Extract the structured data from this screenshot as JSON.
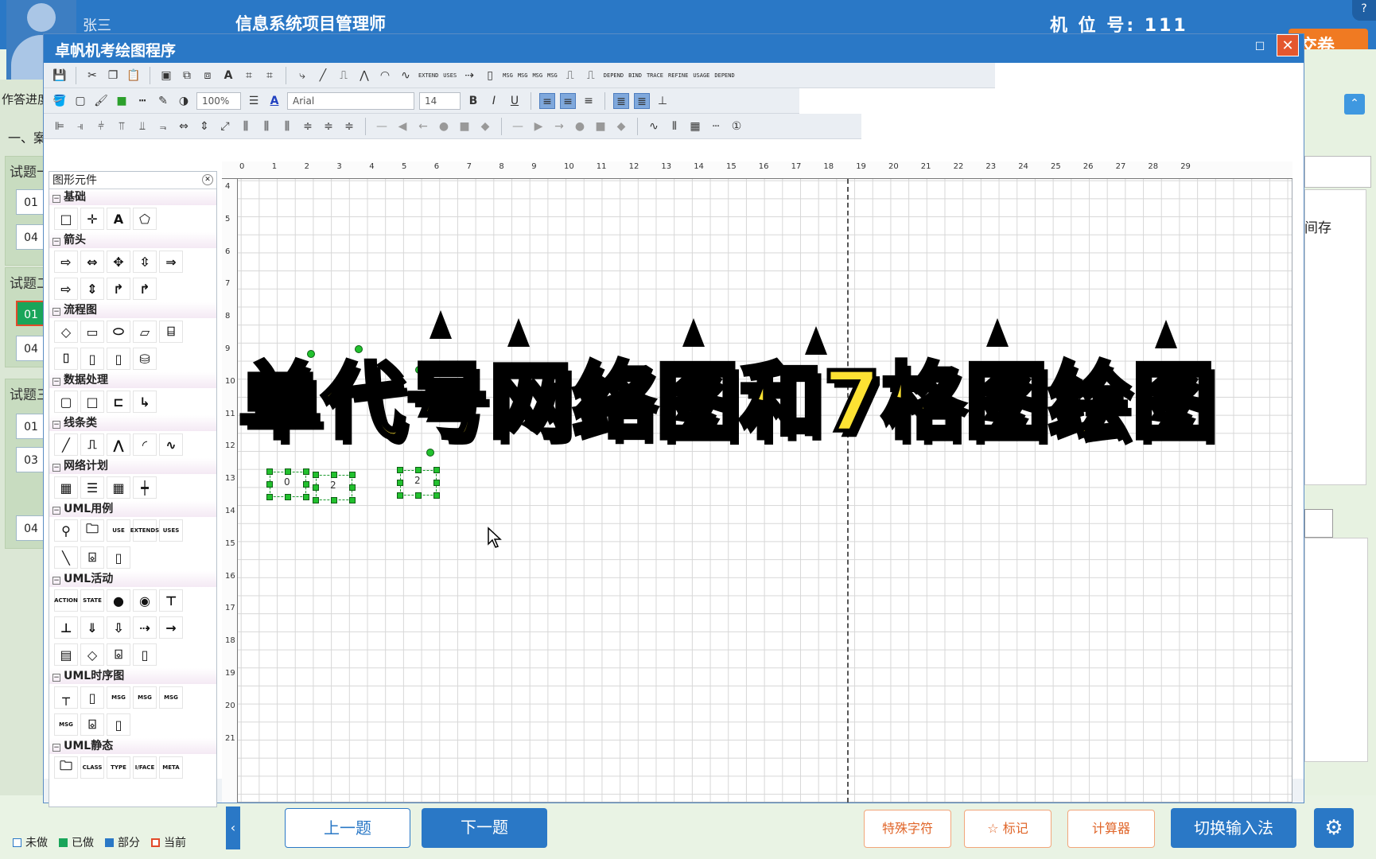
{
  "app": {
    "user_name": "张三",
    "exam_title": "信息系统项目管理师",
    "seat_label": "机 位 号: 111",
    "submit_label": "交卷",
    "help_label": "?",
    "progress_label": "作答进度",
    "section_label": "一、案"
  },
  "questions": [
    {
      "title": "试题一",
      "nums": [
        "01",
        "04"
      ],
      "current": null
    },
    {
      "title": "试题二",
      "nums": [
        "01",
        "04"
      ],
      "current": "01"
    },
    {
      "title": "试题三",
      "nums": [
        "01",
        "03",
        "04"
      ],
      "current": null
    }
  ],
  "right_panel": {
    "text": "间存"
  },
  "bottom": {
    "legend": [
      {
        "label": "未做",
        "color": "#ffffff"
      },
      {
        "label": "已做",
        "color": "#19a55a"
      },
      {
        "label": "部分",
        "color": "#2a78c6"
      },
      {
        "label": "当前",
        "color": "#e24a2a"
      }
    ],
    "prev_label": "上一题",
    "next_label": "下一题",
    "special_char_label": "特殊字符",
    "mark_label": "标记",
    "calculator_label": "计算器",
    "ime_label": "切换输入法"
  },
  "draw_window": {
    "title": "卓帆机考绘图程序",
    "zoom": "100%",
    "font_name": "Arial",
    "font_size": "14",
    "palette_title": "图形元件",
    "categories": [
      {
        "name": "基础",
        "rows": [
          [
            "rect-icon",
            "cross-icon",
            "text-icon",
            "polygon-icon"
          ]
        ]
      },
      {
        "name": "箭头",
        "rows": [
          [
            "arrow-right-icon",
            "arrow-lr-icon",
            "arrow-4way-icon",
            "arrow-3way-icon",
            "chevron-icon"
          ],
          [
            "arrow-tab-icon",
            "arrow-ud-icon",
            "bent-arrow-icon",
            "bent-arrow2-icon"
          ]
        ]
      },
      {
        "name": "流程图",
        "rows": [
          [
            "diamond-icon",
            "process-icon",
            "terminator-icon",
            "data-icon",
            "document-icon"
          ],
          [
            "card-icon",
            "page-icon",
            "drum-icon",
            "cylinder-icon"
          ]
        ]
      },
      {
        "name": "数据处理",
        "rows": [
          [
            "round-rect-icon",
            "square-icon",
            "open-rect-icon",
            "elbow-icon"
          ]
        ]
      },
      {
        "name": "线条类",
        "rows": [
          [
            "line-icon",
            "step-line-icon",
            "zigzag-icon",
            "arc-icon",
            "wave-icon"
          ]
        ]
      },
      {
        "name": "网络计划",
        "rows": [
          [
            "grid7-icon",
            "grid-rows-icon",
            "table-icon",
            "milestone-icon"
          ]
        ]
      },
      {
        "name": "UML用例",
        "rows": [
          [
            "actor-icon",
            "folder-icon",
            "usecase-icon",
            "extends-icon",
            "uses-icon"
          ],
          [
            "assoc-line-icon",
            "comp-icon",
            "note-icon"
          ]
        ]
      },
      {
        "name": "UML活动",
        "rows": [
          [
            "action-icon",
            "state-icon",
            "start-icon",
            "end-icon",
            "fork-icon"
          ],
          [
            "join-icon",
            "merge-icon",
            "decision-icon",
            "flow-dashed-icon",
            "flow-icon"
          ],
          [
            "object-icon",
            "diamond2-icon",
            "comp2-icon",
            "note2-icon"
          ]
        ]
      },
      {
        "name": "UML时序图",
        "rows": [
          [
            "lifeline-icon",
            "activation-icon",
            "msg-icon",
            "msg-sync-icon",
            "msg-return-icon"
          ],
          [
            "msg-self-icon",
            "comp3-icon",
            "note3-icon"
          ]
        ]
      },
      {
        "name": "UML静态",
        "rows": [
          [
            "package-icon",
            "class-icon",
            "type-icon",
            "interface-icon",
            "meta-icon"
          ]
        ]
      }
    ],
    "palette_texts": {
      "text-icon": "A",
      "usecase-icon": "USE",
      "extends-icon": "EXTENDS",
      "uses-icon": "USES",
      "action-icon": "ACTION",
      "state-icon": "STATE",
      "msg-icon": "MSG",
      "msg-sync-icon": "MSG",
      "msg-return-icon": "MSG",
      "msg-self-icon": "MSG",
      "class-icon": "CLASS",
      "type-icon": "TYPE",
      "interface-icon": "I/FACE",
      "meta-icon": "META"
    },
    "connector_labels": [
      "EXTEND",
      "USES",
      "MSG",
      "MSG",
      "MSG",
      "MSG",
      "DEPEND",
      "BIND",
      "TRACE",
      "REFINE",
      "USAGE",
      "DEPEND"
    ],
    "ruler_top": [
      "0",
      "1",
      "2",
      "3",
      "4",
      "5",
      "6",
      "7",
      "8",
      "9",
      "10",
      "11",
      "12",
      "13",
      "14",
      "15",
      "16",
      "17",
      "18",
      "19",
      "20",
      "21",
      "22",
      "23",
      "24",
      "25",
      "26",
      "27",
      "28",
      "29"
    ],
    "ruler_left": [
      "4",
      "5",
      "6",
      "7",
      "8",
      "9",
      "10",
      "11",
      "12",
      "13",
      "14",
      "15",
      "16",
      "17",
      "18",
      "19",
      "20",
      "21"
    ],
    "node_labels": [
      "0",
      "2",
      "2"
    ]
  },
  "overlay_title": "单代号网络图和7格图绘图"
}
